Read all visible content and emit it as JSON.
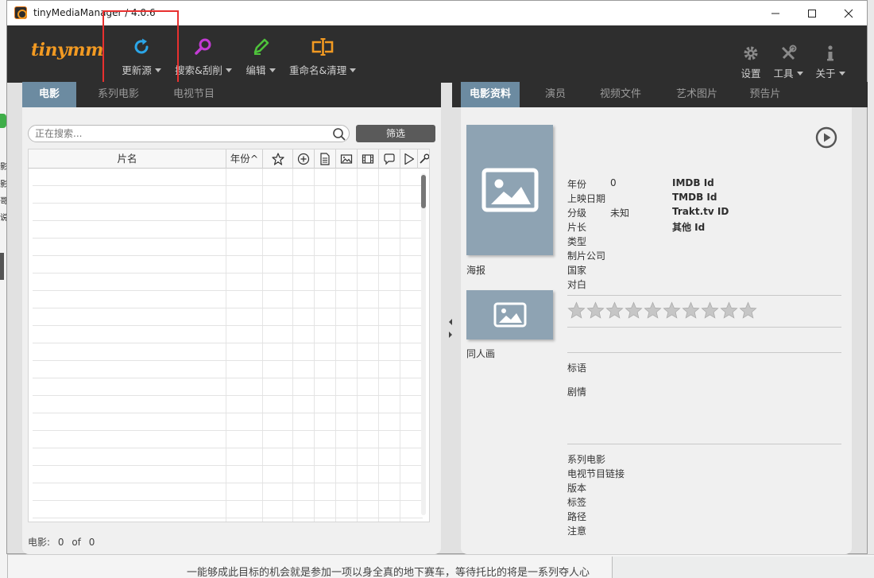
{
  "window": {
    "title": "tinyMediaManager / 4.0.6",
    "minimize": "—",
    "maximize": "☐",
    "close": "✕"
  },
  "toolbar": {
    "logo": "tinymm",
    "update_source": "更新源",
    "search_scrape": "搜索&刮削",
    "edit": "编辑",
    "rename_clean": "重命名&清理",
    "settings": "设置",
    "tools": "工具",
    "about": "关于"
  },
  "colors": {
    "accent_orange": "#f29a22",
    "refresh_blue": "#2ba6e8",
    "search_magenta": "#c33bd4",
    "edit_green": "#4ec33b",
    "tab_active": "#6c8ba1",
    "highlight": "#e8302f"
  },
  "left_tabs": [
    "电影",
    "系列电影",
    "电视节目"
  ],
  "search": {
    "placeholder": "正在搜索..."
  },
  "filter_label": "筛选",
  "table": {
    "columns": {
      "title": "片名",
      "year": "年份^"
    }
  },
  "status": {
    "label": "电影:",
    "count": "0",
    "of": "of",
    "total": "0"
  },
  "right_tabs": [
    "电影资料",
    "演员",
    "视频文件",
    "艺术图片",
    "预告片"
  ],
  "details": {
    "poster_label": "海报",
    "fanart_label": "同人画",
    "year_label": "年份",
    "year_value": "0",
    "release_label": "上映日期",
    "rating_label": "分级",
    "rating_value": "未知",
    "runtime_label": "片长",
    "genre_label": "类型",
    "studio_label": "制片公司",
    "country_label": "国家",
    "dialogue_label": "对白",
    "imdb_label": "IMDB Id",
    "tmdb_label": "TMDB Id",
    "trakt_label": "Trakt.tv ID",
    "other_label": "其他 Id",
    "tagline_label": "标语",
    "plot_label": "剧情",
    "collection_label": "系列电影",
    "tvshow_link_label": "电视节目链接",
    "edition_label": "版本",
    "tags_label": "标签",
    "path_label": "路径",
    "note_label": "注意"
  },
  "star_rating": {
    "value": 0,
    "max": 10
  },
  "background": {
    "bottom_text": "一能够成此目标的机会就是参加一项以身全真的地下赛车，等待托比的将是一系列夺人心",
    "left_fragments": [
      "影",
      "影",
      "哥",
      "说"
    ]
  }
}
